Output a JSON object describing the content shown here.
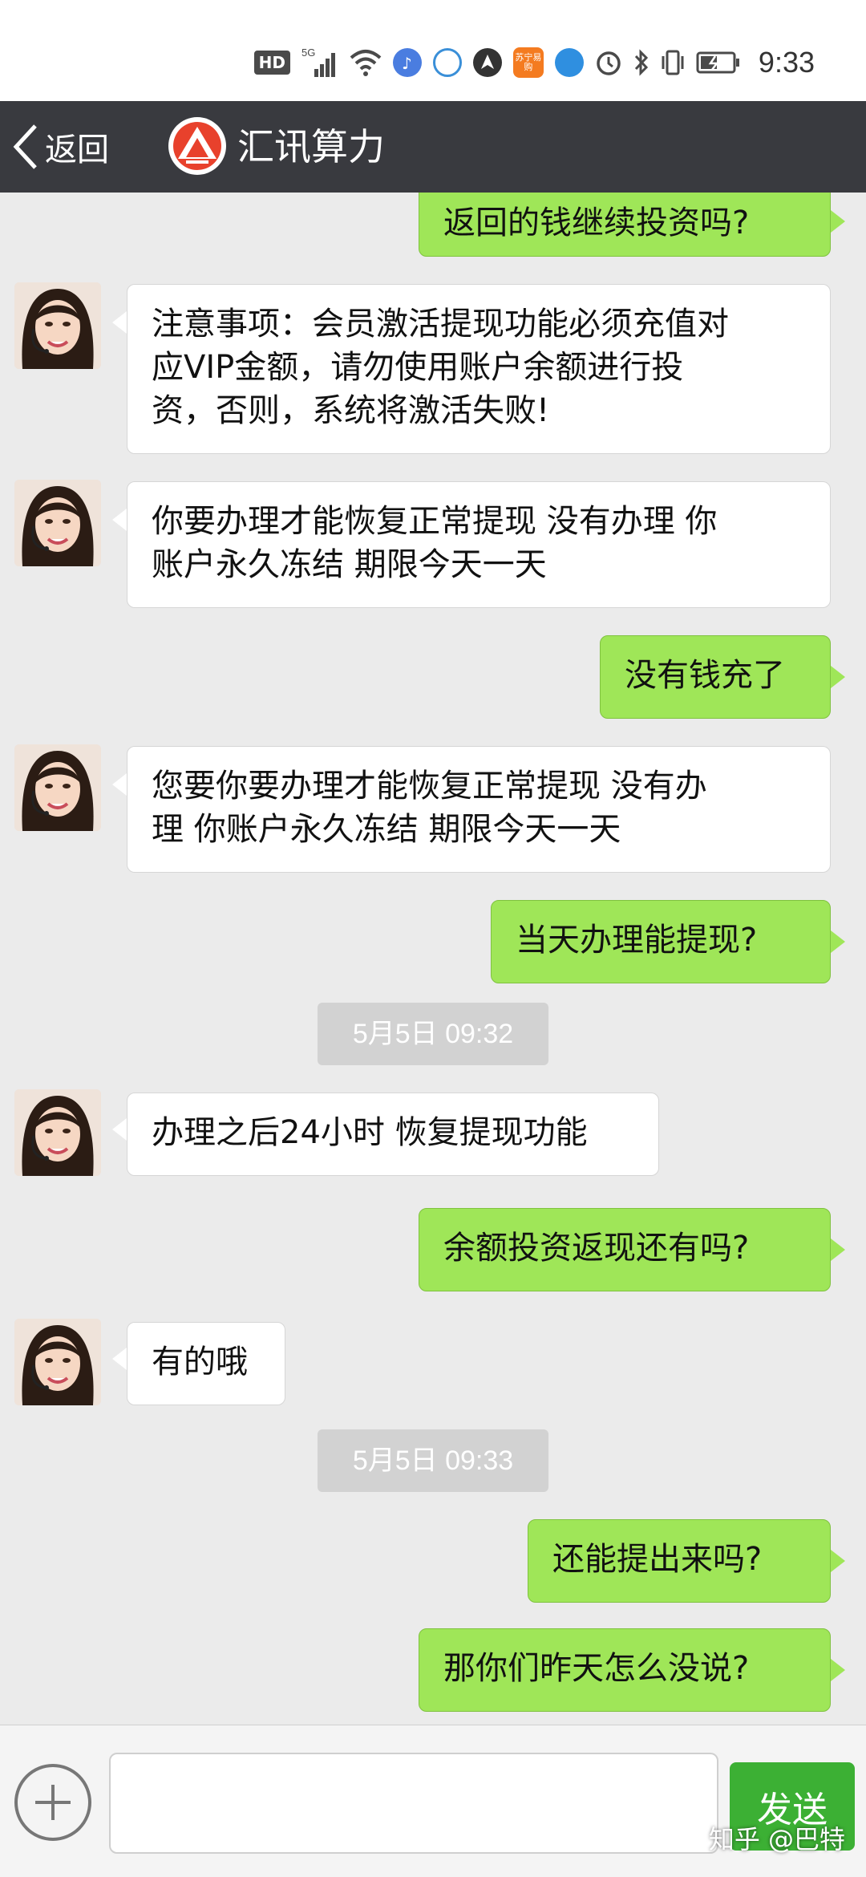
{
  "status_bar": {
    "hd_label": "HD",
    "network_label": "5G",
    "shop_label": "苏宁易购",
    "time": "9:33"
  },
  "header": {
    "back_label": "返回",
    "title": "汇讯算力"
  },
  "messages": [
    {
      "side": "out",
      "text": "返回的钱继续投资吗?"
    },
    {
      "side": "in",
      "line1": "注意事项：会员激活提现功能必须充值对",
      "line2": "应VIP金额，请勿使用账户余额进行投",
      "line3": "资，否则，系统将激活失败!"
    },
    {
      "side": "in",
      "line1": "你要办理才能恢复正常提现 没有办理 你",
      "line2": "账户永久冻结  期限今天一天"
    },
    {
      "side": "out",
      "text": "没有钱充了"
    },
    {
      "side": "in",
      "line1": "您要你要办理才能恢复正常提现 没有办",
      "line2": "理 你账户永久冻结  期限今天一天"
    },
    {
      "side": "out",
      "text": "当天办理能提现?"
    },
    {
      "side": "in",
      "text": "办理之后24小时 恢复提现功能"
    },
    {
      "side": "out",
      "text": "余额投资返现还有吗?"
    },
    {
      "side": "in",
      "text": "有的哦"
    },
    {
      "side": "out",
      "text": "还能提出来吗?"
    },
    {
      "side": "out",
      "text": "那你们昨天怎么没说?"
    }
  ],
  "timestamps": [
    "5月5日 09:32",
    "5月5日 09:33"
  ],
  "input_bar": {
    "input_value": "",
    "send_label": "发送"
  },
  "watermark": "知乎 @巴特",
  "colors": {
    "header_bg": "#393a3f",
    "outgoing_bubble": "#9fe658",
    "incoming_bubble": "#ffffff",
    "send_button": "#3cb034",
    "chat_bg": "#ebebeb"
  }
}
